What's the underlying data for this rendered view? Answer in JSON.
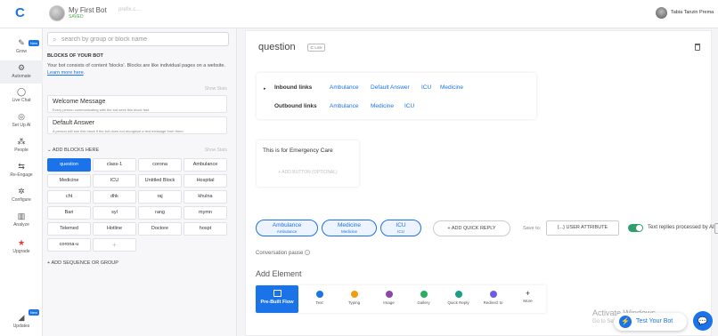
{
  "topbar": {
    "bot_name": "My First Bot",
    "bot_status": "SAVED",
    "prefix_placeholder": "prefix.c...",
    "user_name": "Tabia Tanzin Prema"
  },
  "nav": [
    {
      "label": "Grow",
      "icon": "pencil-icon"
    },
    {
      "label": "Automate",
      "icon": "gear-cluster-icon"
    },
    {
      "label": "Live Chat",
      "icon": "chat-bubble-icon"
    },
    {
      "label": "Set Up AI",
      "icon": "ai-brain-icon"
    },
    {
      "label": "People",
      "icon": "people-icon"
    },
    {
      "label": "Re-Engage",
      "icon": "reengage-icon"
    },
    {
      "label": "Configure",
      "icon": "settings-icon"
    },
    {
      "label": "Analyze",
      "icon": "bar-chart-icon"
    },
    {
      "label": "Upgrade",
      "icon": "star-icon"
    },
    {
      "label": "Updates",
      "icon": "megaphone-icon"
    }
  ],
  "badges": {
    "new": "New"
  },
  "sidebar": {
    "search_placeholder": "search by group or block name",
    "section_title": "BLOCKS OF YOUR BOT",
    "description": "Your bot consists of content 'blocks'. Blocks are like individual pages on a website.",
    "learn_more": "Learn more here",
    "show_stats": "Show Stats",
    "welcome": {
      "title": "Welcome Message",
      "subtitle": "Every person communicating with the bot sees this block first."
    },
    "default": {
      "title": "Default Answer",
      "subtitle": "A person will see this block if the bot does not recognize a text message from them."
    },
    "add_blocks": "ADD BLOCKS HERE",
    "blocks": [
      "question",
      "class-1",
      "corona",
      "Ambulance",
      "Medicine",
      "ICU",
      "Untitled Block",
      "Hospital",
      "cht",
      "dhk",
      "raj",
      "khulna",
      "Bari",
      "syl",
      "rang",
      "mymn",
      "Telemed",
      "Hotline",
      "Doctore",
      "hospt",
      "corona-u",
      "+"
    ],
    "add_sequence": "ADD SEQUENCE OR GROUP"
  },
  "editor": {
    "block_title": "question",
    "link_label": "Link",
    "inbound_label": "Inbound links",
    "inbound_links": [
      "Ambulance",
      "Default Answer",
      "ICU",
      "Medicine"
    ],
    "outbound_label": "Outbound links",
    "outbound_links": [
      "Ambulance",
      "Medicine",
      "ICU"
    ],
    "message_text": "This is for Emergency Care",
    "add_button": "+ ADD BUTTON (OPTIONAL)",
    "quick_replies": [
      {
        "label": "Ambulance",
        "sub": "Ambulance"
      },
      {
        "label": "Medicine",
        "sub": "Medicine"
      },
      {
        "label": "ICU",
        "sub": "ICU"
      }
    ],
    "add_quick_reply": "+ ADD QUICK REPLY",
    "save_to": "Save to:",
    "user_attribute": "{...} USER ATTRIBUTE",
    "toggle_label": "Text replies processed by AI",
    "conversation_pause": "Conversation pause",
    "add_element": "Add Element",
    "elements": [
      {
        "label": "Pre-Built Flow",
        "color": "#1a73e8"
      },
      {
        "label": "Text",
        "color": "#1a73e8"
      },
      {
        "label": "Typing",
        "color": "#f39c12"
      },
      {
        "label": "Image",
        "color": "#8e44ad"
      },
      {
        "label": "Gallery",
        "color": "#27ae60"
      },
      {
        "label": "Quick Reply",
        "color": "#16a085"
      },
      {
        "label": "Redirect to",
        "color": "#6c5ce7"
      },
      {
        "label": "More",
        "color": "#333333"
      }
    ]
  },
  "overlay": {
    "activate_title": "Activate Windows",
    "activate_sub": "Go to Settings to activate Windows.",
    "test_bot": "Test Your Bot"
  }
}
